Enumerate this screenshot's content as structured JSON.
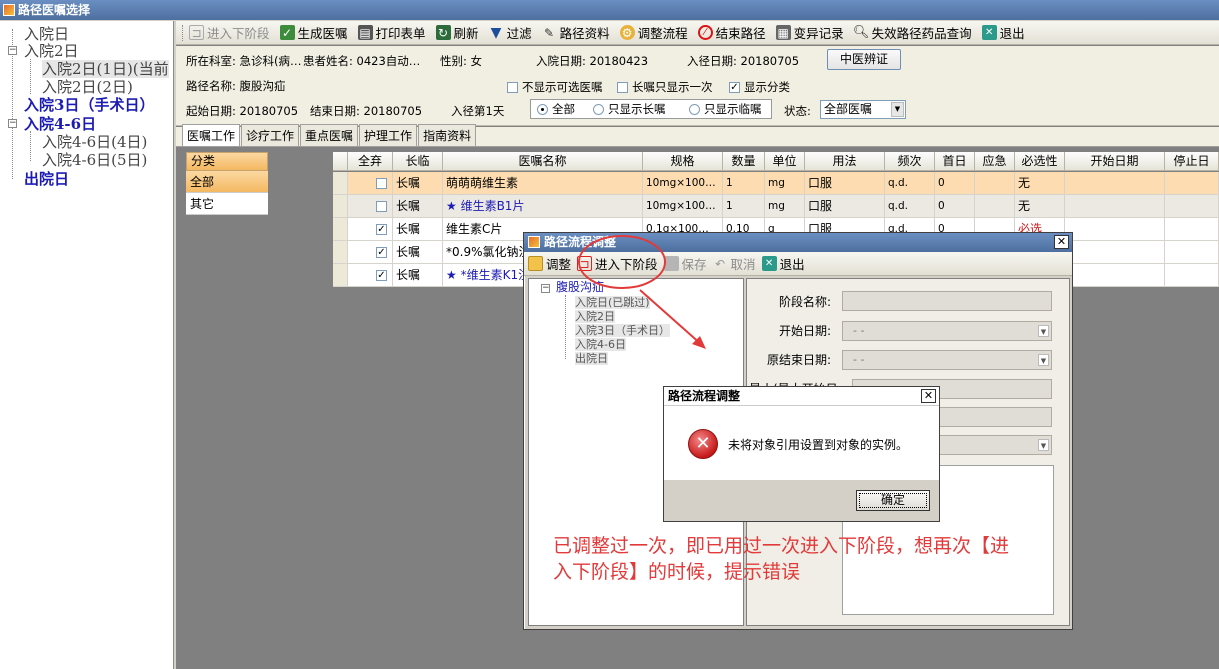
{
  "window": {
    "title": "路径医嘱选择"
  },
  "tree": {
    "items": [
      {
        "label": "入院日"
      },
      {
        "label": "入院2日"
      },
      {
        "label": "入院2日(1日)(当前"
      },
      {
        "label": "入院2日(2日)"
      },
      {
        "label": "入院3日（手术日）"
      },
      {
        "label": "入院4-6日"
      },
      {
        "label": "入院4-6日(4日)"
      },
      {
        "label": "入院4-6日(5日)"
      },
      {
        "label": "出院日"
      }
    ]
  },
  "toolbar": {
    "next_stage": "进入下阶段",
    "generate_orders": "生成医嘱",
    "print_form": "打印表单",
    "refresh": "刷新",
    "filter": "过滤",
    "pathway_info": "路径资料",
    "adjust_flow": "调整流程",
    "end_pathway": "结束路径",
    "variation_log": "变异记录",
    "expired_drug_query": "失效路径药品查询",
    "exit": "退出"
  },
  "info": {
    "dept": "所在科室: 急诊科(病…",
    "patient": "患者姓名: 0423自动…",
    "gender": "性别: 女",
    "admit_date": "入院日期: 20180423",
    "enter_date": "入径日期: 20180705",
    "tcm_button": "中医辨证",
    "path_name": "路径名称: 腹股沟疝",
    "hide_optional": "不显示可选医嘱",
    "long_once": "长嘱只显示一次",
    "show_category": "显示分类",
    "start_date": "起始日期: 20180705",
    "end_date": "结束日期: 20180705",
    "day_in_path": "入径第1天",
    "radio_all": "全部",
    "radio_long": "只显示长嘱",
    "radio_temp": "只显示临嘱",
    "status_label": "状态:",
    "status_value": "全部医嘱"
  },
  "tabs": [
    "医嘱工作",
    "诊疗工作",
    "重点医嘱",
    "护理工作",
    "指南资料"
  ],
  "categories": {
    "header": "分类",
    "items": [
      "全部",
      "其它"
    ]
  },
  "grid": {
    "columns": [
      "全弃",
      "长临",
      "医嘱名称",
      "规格",
      "数量",
      "单位",
      "用法",
      "频次",
      "首日",
      "应急",
      "必选性",
      "开始日期",
      "停止日"
    ],
    "rows": [
      {
        "checked": false,
        "type": "长嘱",
        "star": false,
        "name": "萌萌萌维生素",
        "spec": "10mg×100…",
        "qty": "1",
        "unit": "mg",
        "usage": "口服",
        "freq": "q.d.",
        "first": "0",
        "urgent": "",
        "required": "无"
      },
      {
        "checked": false,
        "type": "长嘱",
        "star": true,
        "name": "维生素B1片",
        "spec": "10mg×100…",
        "qty": "1",
        "unit": "mg",
        "usage": "口服",
        "freq": "q.d.",
        "first": "0",
        "urgent": "",
        "required": "无"
      },
      {
        "checked": true,
        "type": "长嘱",
        "star": false,
        "name": "维生素C片",
        "spec": "0.1g×100…",
        "qty": "0.10",
        "unit": "g",
        "usage": "口服",
        "freq": "q.d.",
        "first": "0",
        "urgent": "",
        "required": "必选"
      },
      {
        "checked": true,
        "type": "长嘱",
        "star": false,
        "name": "*0.9%氯化钠注",
        "spec": "",
        "qty": "",
        "unit": "",
        "usage": "",
        "freq": "",
        "first": "",
        "urgent": "",
        "required": ""
      },
      {
        "checked": true,
        "type": "长嘱",
        "star": true,
        "name": "*维生素K1注",
        "spec": "",
        "qty": "",
        "unit": "",
        "usage": "",
        "freq": "",
        "first": "",
        "urgent": "",
        "required": ""
      }
    ]
  },
  "flow_dialog": {
    "title": "路径流程调整",
    "toolbar": {
      "adjust": "调整",
      "next_stage": "进入下阶段",
      "save": "保存",
      "cancel": "取消",
      "exit": "退出"
    },
    "tree_root": "腹股沟疝",
    "tree_items": [
      "入院日(已跳过)",
      "入院2日",
      "入院3日（手术日）",
      "入院4-6日",
      "出院日"
    ],
    "form": {
      "stage_name": "阶段名称:",
      "start_date": "开始日期:",
      "orig_end_date": "原结束日期:",
      "latest_start": "最小(最大开始日:",
      "date_placeholder": "-   -"
    }
  },
  "error_dialog": {
    "title": "路径流程调整",
    "message": "未将对象引用设置到对象的实例。",
    "ok": "确定"
  },
  "annotation": {
    "line1": "已调整过一次，即已用过一次进入下阶段，想再次【进",
    "line2": "入下阶段】的时候，提示错误"
  }
}
